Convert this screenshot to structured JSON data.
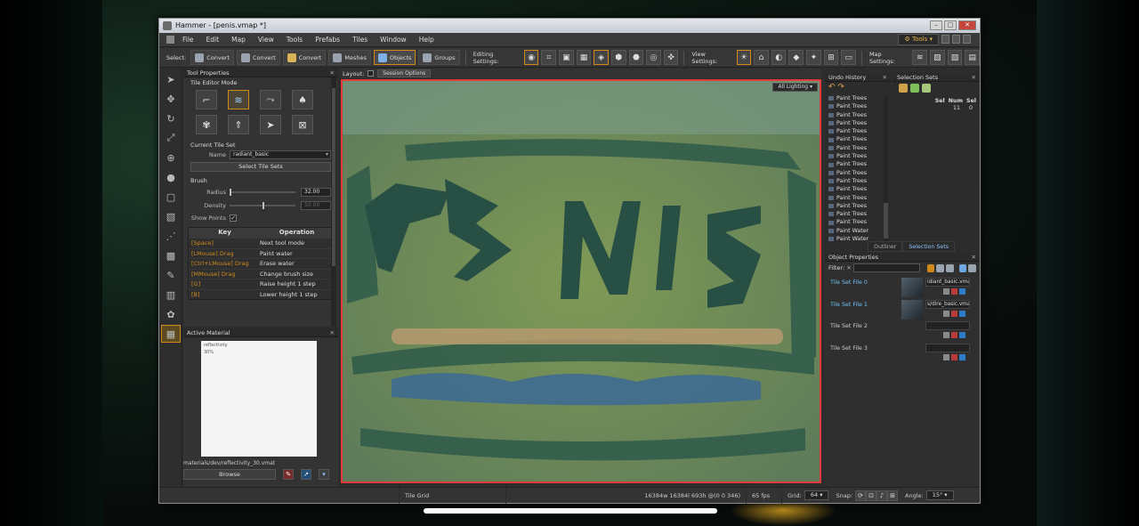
{
  "window": {
    "title": "Hammer - [penis.vmap *]"
  },
  "menu": [
    "File",
    "Edit",
    "Map",
    "View",
    "Tools",
    "Prefabs",
    "Tiles",
    "Window",
    "Help"
  ],
  "tools_button": "Tools",
  "toolbar": {
    "select_label": "Select:",
    "select_buttons": [
      "Convert",
      "Convert",
      "Convert",
      "Meshes",
      "Objects",
      "Groups"
    ],
    "editing_label": "Editing Settings:",
    "view_label": "View Settings:",
    "map_label": "Map Settings:"
  },
  "tool_properties": {
    "title": "Tool Properties",
    "mode_section": "Tile Editor Mode",
    "tileset_section": "Current Tile Set",
    "name_label": "Name",
    "name_value": "radiant_basic",
    "select_button": "Select Tile Sets",
    "brush_section": "Brush",
    "radius_label": "Radius",
    "radius_value": "32.00",
    "radius_fraction": 0.0,
    "density_label": "Density",
    "density_value": "50.00",
    "density_fraction": 0.5,
    "show_points_label": "Show Points",
    "show_points": true,
    "key_header": "Key",
    "op_header": "Operation",
    "keys": [
      {
        "key": "[Space]",
        "op": "Next tool mode"
      },
      {
        "key": "[LMouse] Drag",
        "op": "Paint water"
      },
      {
        "key": "[Ctrl+LMouse] Drag",
        "op": "Erase water"
      },
      {
        "key": "[MMouse] Drag",
        "op": "Change brush size"
      },
      {
        "key": "[G]",
        "op": "Raise height 1 step"
      },
      {
        "key": "[B]",
        "op": "Lower height 1 step"
      }
    ]
  },
  "active_material": {
    "title": "Active Material",
    "preview_line1": "reflectivity",
    "preview_line2": "30%",
    "path": "materials/dev/reflectivity_30.vmat",
    "browse": "Browse"
  },
  "viewport": {
    "layout_label": "Layout:",
    "session_options": "Session Options",
    "lighting": "All Lighting"
  },
  "undo_history": {
    "title": "Undo History",
    "items": [
      "Paint Trees",
      "Paint Trees",
      "Paint Trees",
      "Paint Trees",
      "Paint Trees",
      "Paint Trees",
      "Paint Trees",
      "Paint Trees",
      "Paint Trees",
      "Paint Trees",
      "Paint Trees",
      "Paint Trees",
      "Paint Trees",
      "Paint Trees",
      "Paint Trees",
      "Paint Trees",
      "Paint Water",
      "Paint Water"
    ]
  },
  "selection_sets": {
    "title": "Selection Sets",
    "cols": [
      "Sel",
      "Num",
      "Sel"
    ],
    "row": [
      "11",
      "0"
    ],
    "tab_outliner": "Outliner",
    "tab_selection": "Selection Sets"
  },
  "object_properties": {
    "title": "Object Properties",
    "filter_label": "Filter:",
    "tile_sets": [
      {
        "label": "Tile Set File 0",
        "value": "idiant_basic.vmap",
        "active": true,
        "thumb": true
      },
      {
        "label": "Tile Set File 1",
        "value": "s/dire_basic.vmap",
        "active": true,
        "thumb": true
      },
      {
        "label": "Tile Set File 2",
        "value": "",
        "active": false,
        "thumb": false
      },
      {
        "label": "Tile Set File 3",
        "value": "",
        "active": false,
        "thumb": false
      }
    ]
  },
  "status": {
    "tile_grid": "Tile Grid",
    "dims": "16384w 16384l 693h @(0 0 346)",
    "fps": "65 fps",
    "grid_label": "Grid:",
    "grid_value": "64",
    "snap_label": "Snap:",
    "angle_label": "Angle:",
    "angle_value": "15°"
  },
  "colors": {
    "accent": "#d08a1c",
    "viewport_border": "#e43a3a",
    "link_blue": "#6fc3f5"
  }
}
